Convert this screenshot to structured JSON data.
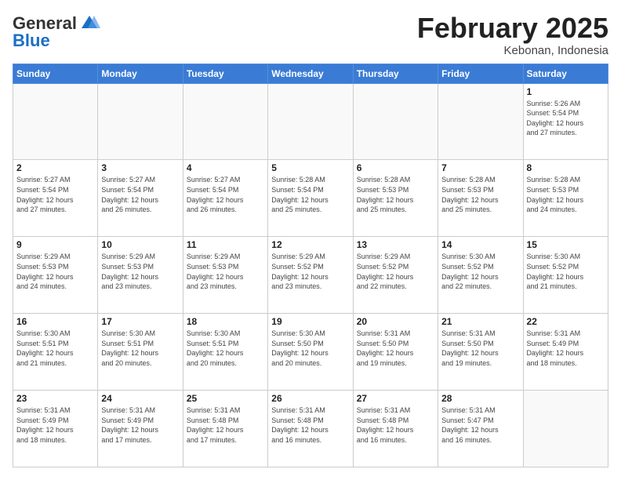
{
  "header": {
    "logo_line1": "General",
    "logo_line2": "Blue",
    "month_title": "February 2025",
    "location": "Kebonan, Indonesia"
  },
  "days_of_week": [
    "Sunday",
    "Monday",
    "Tuesday",
    "Wednesday",
    "Thursday",
    "Friday",
    "Saturday"
  ],
  "weeks": [
    [
      {
        "day": "",
        "info": ""
      },
      {
        "day": "",
        "info": ""
      },
      {
        "day": "",
        "info": ""
      },
      {
        "day": "",
        "info": ""
      },
      {
        "day": "",
        "info": ""
      },
      {
        "day": "",
        "info": ""
      },
      {
        "day": "1",
        "info": "Sunrise: 5:26 AM\nSunset: 5:54 PM\nDaylight: 12 hours\nand 27 minutes."
      }
    ],
    [
      {
        "day": "2",
        "info": "Sunrise: 5:27 AM\nSunset: 5:54 PM\nDaylight: 12 hours\nand 27 minutes."
      },
      {
        "day": "3",
        "info": "Sunrise: 5:27 AM\nSunset: 5:54 PM\nDaylight: 12 hours\nand 26 minutes."
      },
      {
        "day": "4",
        "info": "Sunrise: 5:27 AM\nSunset: 5:54 PM\nDaylight: 12 hours\nand 26 minutes."
      },
      {
        "day": "5",
        "info": "Sunrise: 5:28 AM\nSunset: 5:54 PM\nDaylight: 12 hours\nand 25 minutes."
      },
      {
        "day": "6",
        "info": "Sunrise: 5:28 AM\nSunset: 5:53 PM\nDaylight: 12 hours\nand 25 minutes."
      },
      {
        "day": "7",
        "info": "Sunrise: 5:28 AM\nSunset: 5:53 PM\nDaylight: 12 hours\nand 25 minutes."
      },
      {
        "day": "8",
        "info": "Sunrise: 5:28 AM\nSunset: 5:53 PM\nDaylight: 12 hours\nand 24 minutes."
      }
    ],
    [
      {
        "day": "9",
        "info": "Sunrise: 5:29 AM\nSunset: 5:53 PM\nDaylight: 12 hours\nand 24 minutes."
      },
      {
        "day": "10",
        "info": "Sunrise: 5:29 AM\nSunset: 5:53 PM\nDaylight: 12 hours\nand 23 minutes."
      },
      {
        "day": "11",
        "info": "Sunrise: 5:29 AM\nSunset: 5:53 PM\nDaylight: 12 hours\nand 23 minutes."
      },
      {
        "day": "12",
        "info": "Sunrise: 5:29 AM\nSunset: 5:52 PM\nDaylight: 12 hours\nand 23 minutes."
      },
      {
        "day": "13",
        "info": "Sunrise: 5:29 AM\nSunset: 5:52 PM\nDaylight: 12 hours\nand 22 minutes."
      },
      {
        "day": "14",
        "info": "Sunrise: 5:30 AM\nSunset: 5:52 PM\nDaylight: 12 hours\nand 22 minutes."
      },
      {
        "day": "15",
        "info": "Sunrise: 5:30 AM\nSunset: 5:52 PM\nDaylight: 12 hours\nand 21 minutes."
      }
    ],
    [
      {
        "day": "16",
        "info": "Sunrise: 5:30 AM\nSunset: 5:51 PM\nDaylight: 12 hours\nand 21 minutes."
      },
      {
        "day": "17",
        "info": "Sunrise: 5:30 AM\nSunset: 5:51 PM\nDaylight: 12 hours\nand 20 minutes."
      },
      {
        "day": "18",
        "info": "Sunrise: 5:30 AM\nSunset: 5:51 PM\nDaylight: 12 hours\nand 20 minutes."
      },
      {
        "day": "19",
        "info": "Sunrise: 5:30 AM\nSunset: 5:50 PM\nDaylight: 12 hours\nand 20 minutes."
      },
      {
        "day": "20",
        "info": "Sunrise: 5:31 AM\nSunset: 5:50 PM\nDaylight: 12 hours\nand 19 minutes."
      },
      {
        "day": "21",
        "info": "Sunrise: 5:31 AM\nSunset: 5:50 PM\nDaylight: 12 hours\nand 19 minutes."
      },
      {
        "day": "22",
        "info": "Sunrise: 5:31 AM\nSunset: 5:49 PM\nDaylight: 12 hours\nand 18 minutes."
      }
    ],
    [
      {
        "day": "23",
        "info": "Sunrise: 5:31 AM\nSunset: 5:49 PM\nDaylight: 12 hours\nand 18 minutes."
      },
      {
        "day": "24",
        "info": "Sunrise: 5:31 AM\nSunset: 5:49 PM\nDaylight: 12 hours\nand 17 minutes."
      },
      {
        "day": "25",
        "info": "Sunrise: 5:31 AM\nSunset: 5:48 PM\nDaylight: 12 hours\nand 17 minutes."
      },
      {
        "day": "26",
        "info": "Sunrise: 5:31 AM\nSunset: 5:48 PM\nDaylight: 12 hours\nand 16 minutes."
      },
      {
        "day": "27",
        "info": "Sunrise: 5:31 AM\nSunset: 5:48 PM\nDaylight: 12 hours\nand 16 minutes."
      },
      {
        "day": "28",
        "info": "Sunrise: 5:31 AM\nSunset: 5:47 PM\nDaylight: 12 hours\nand 16 minutes."
      },
      {
        "day": "",
        "info": ""
      }
    ]
  ]
}
